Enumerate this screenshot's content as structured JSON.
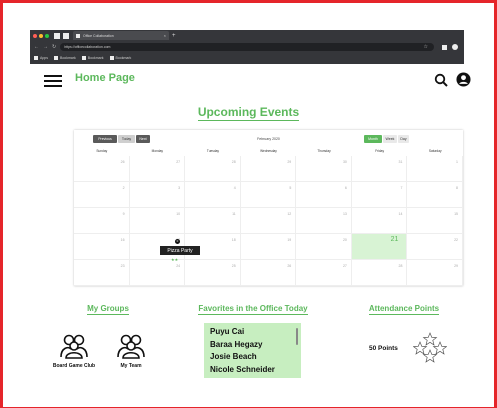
{
  "browser": {
    "tab_title": "Office Collaboration",
    "tab_close": "×",
    "new_tab": "+",
    "url": "https://officecollaboration.com",
    "bookmarks": [
      "Apps",
      "Bookmark",
      "Bookmark",
      "Bookmark"
    ]
  },
  "header": {
    "title": "Home Page",
    "menu_icon": "hamburger-menu-icon",
    "search_icon": "search-icon",
    "account_icon": "account-circle-icon"
  },
  "events": {
    "title": "Upcoming Events",
    "toolbar": {
      "previous": "Previous",
      "today": "Today",
      "next": "Next",
      "month_label": "February 2020",
      "month": "Month",
      "week": "Week",
      "day": "Day"
    },
    "weekdays": [
      "Sunday",
      "Monday",
      "Tuesday",
      "Wednesday",
      "Thursday",
      "Friday",
      "Saturday"
    ],
    "weeks": [
      [
        "26",
        "27",
        "28",
        "29",
        "30",
        "31",
        "1"
      ],
      [
        "2",
        "3",
        "4",
        "5",
        "6",
        "7",
        "8"
      ],
      [
        "9",
        "10",
        "11",
        "12",
        "13",
        "14",
        "15"
      ],
      [
        "16",
        "17",
        "18",
        "19",
        "20",
        "21",
        "22"
      ],
      [
        "23",
        "24",
        "25",
        "26",
        "27",
        "28",
        "29"
      ]
    ],
    "highlight_day": "21",
    "event": {
      "badge": "0",
      "label": "Pizza Party",
      "dots": "★★"
    }
  },
  "groups": {
    "title": "My Groups",
    "items": [
      {
        "label": "Board Game Club",
        "icon": "group-icon"
      },
      {
        "label": "My Team",
        "icon": "group-icon"
      }
    ]
  },
  "favorites": {
    "title": "Favorites in the Office Today",
    "people": [
      "Puyu Cai",
      "Baraa Hegazy",
      "Josie Beach",
      "Nicole Schneider"
    ]
  },
  "attendance": {
    "title": "Attendance Points",
    "points": "50 Points",
    "stars_icon": "stars-icon"
  },
  "colors": {
    "accent": "#5cb85c",
    "highlight": "#d8f3d4",
    "favorites_bg": "#c7eec0",
    "frame": "#e5252a"
  }
}
